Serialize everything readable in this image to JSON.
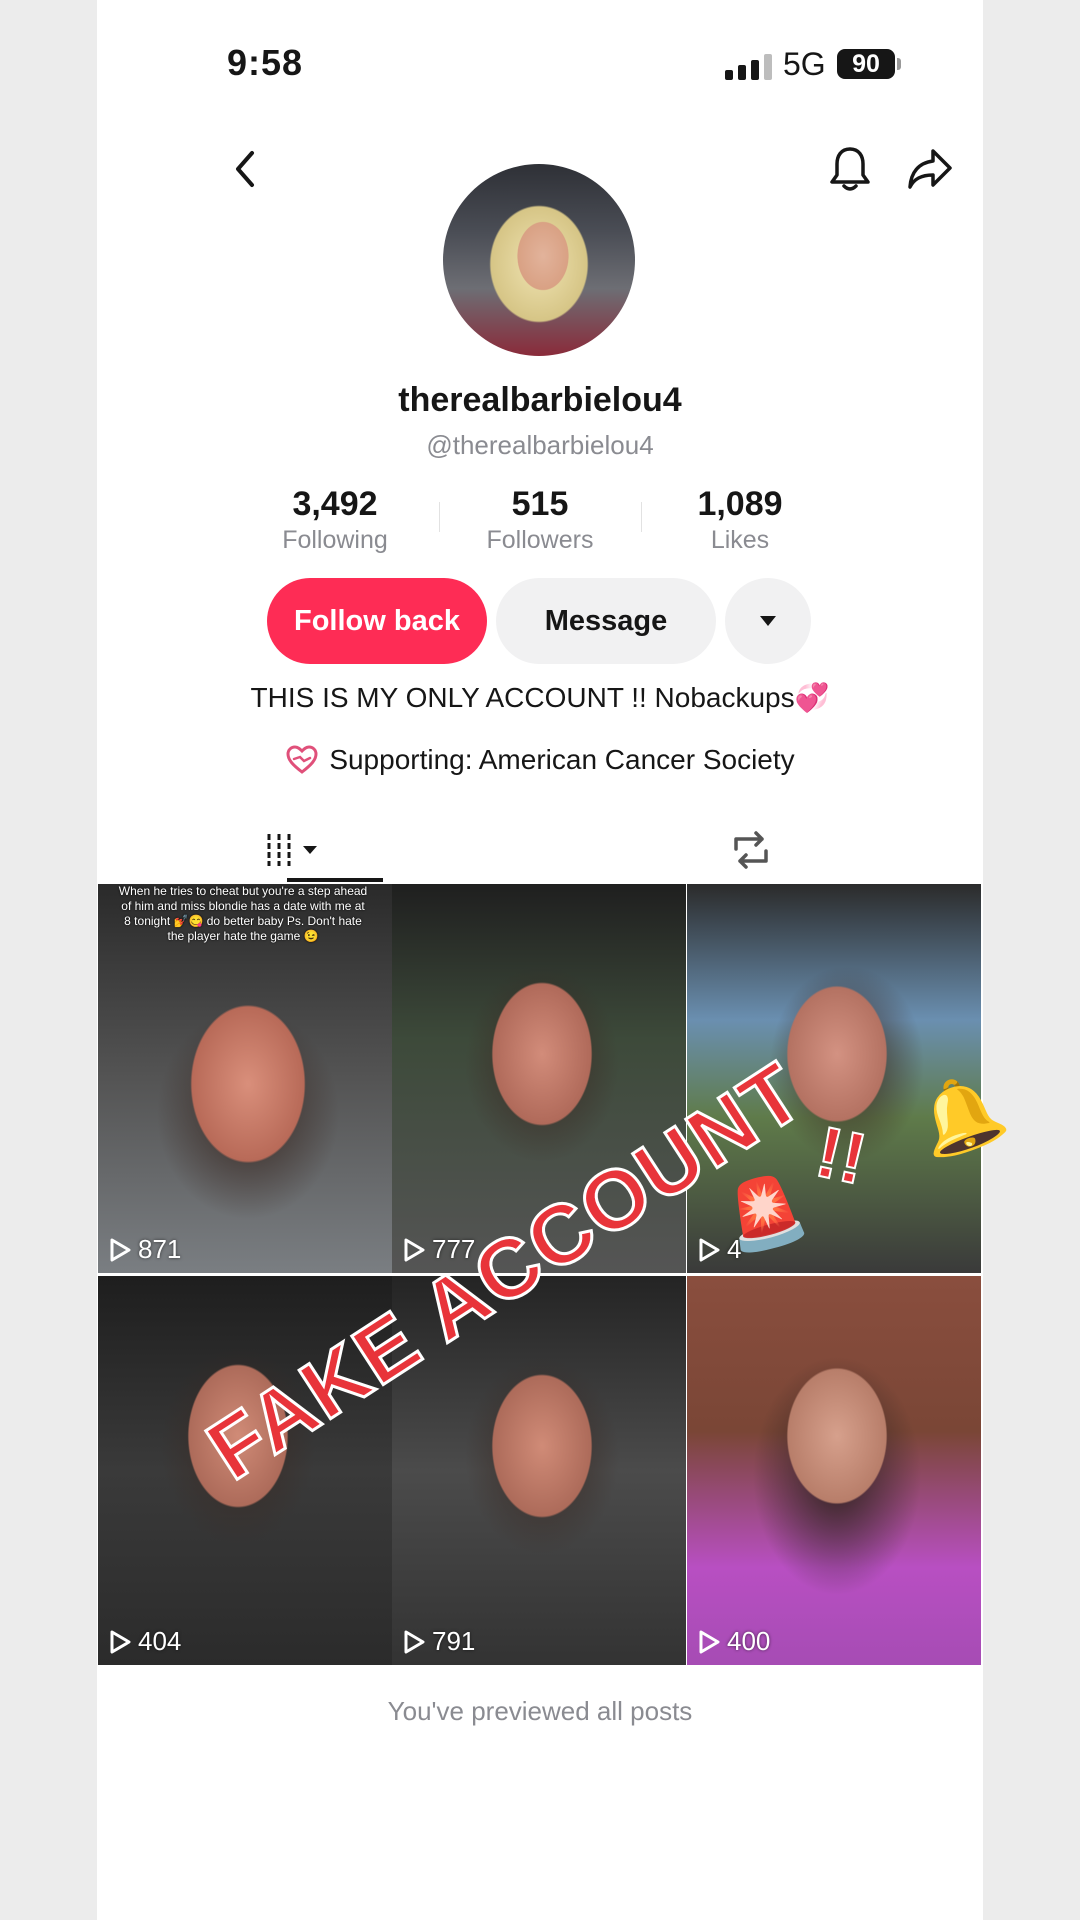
{
  "status_bar": {
    "time": "9:58",
    "network": "5G",
    "battery": "90"
  },
  "header": {
    "back_icon": "chevron-left-icon",
    "bell_icon": "bell-icon",
    "share_icon": "share-arrow-icon"
  },
  "profile": {
    "display_name": "therealbarbielou4",
    "handle": "@therealbarbielou4",
    "stats": [
      {
        "value": "3,492",
        "label": "Following"
      },
      {
        "value": "515",
        "label": "Followers"
      },
      {
        "value": "1,089",
        "label": "Likes"
      }
    ],
    "buttons": {
      "follow_back": "Follow back",
      "message": "Message"
    },
    "bio": "THIS IS MY ONLY ACCOUNT !! Nobackups💞",
    "supporting": "Supporting: American Cancer Society"
  },
  "tabs": {
    "grid_icon": "grid-lines-icon",
    "repost_icon": "repost-icon"
  },
  "videos": [
    {
      "views": "871",
      "overlay": "When he tries to cheat but you're a step ahead of him and miss blondie has a date with me at 8 tonight 💅😋 do better baby Ps. Don't hate the player hate the game 😉"
    },
    {
      "views": "777"
    },
    {
      "views": "4"
    },
    {
      "views": "404"
    },
    {
      "views": "791"
    },
    {
      "views": "400"
    }
  ],
  "stickers": {
    "fake": "FAKE ACCOUNT",
    "siren": "🚨",
    "bang": "!!",
    "bell": "🔔"
  },
  "footer": "You've previewed all posts",
  "colors": {
    "accent": "#fe2c55",
    "stamp": "#e8343a"
  }
}
